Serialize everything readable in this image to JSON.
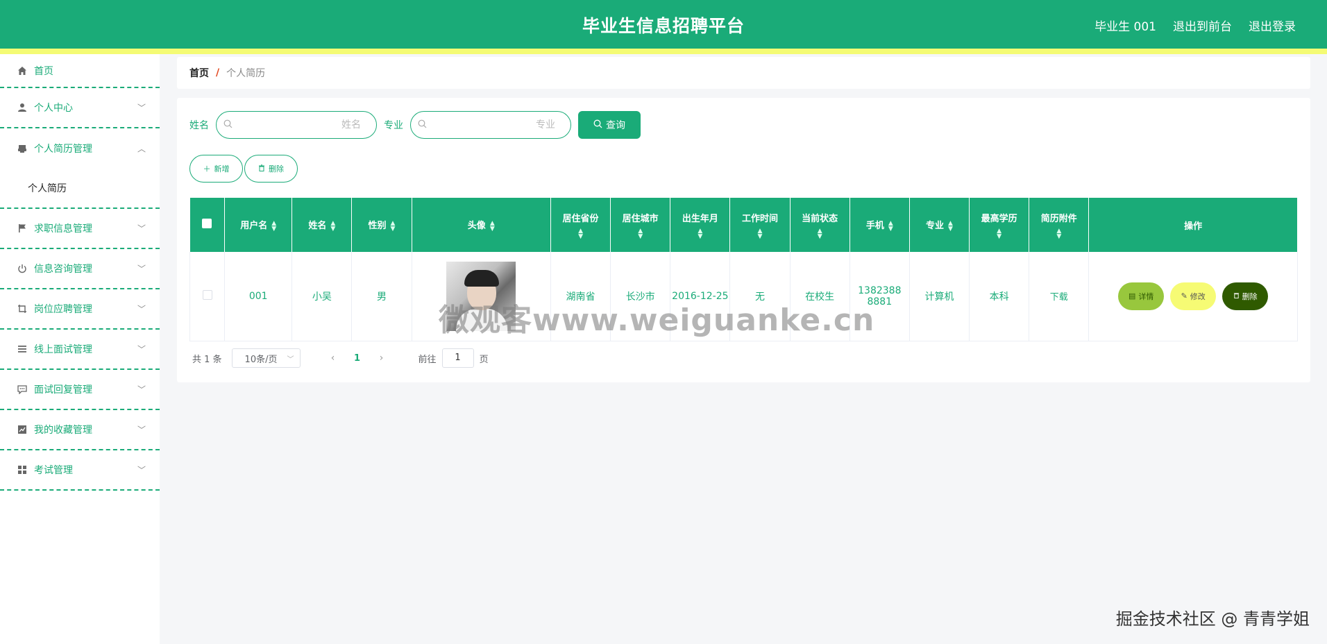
{
  "header": {
    "title": "毕业生信息招聘平台",
    "user": "毕业生 001",
    "to_front": "退出到前台",
    "logout": "退出登录"
  },
  "sidebar": {
    "items": [
      {
        "label": "首页",
        "icon": "home-icon"
      },
      {
        "label": "个人中心",
        "icon": "user-icon"
      },
      {
        "label": "个人简历管理",
        "icon": "printer-icon"
      },
      {
        "label": "个人简历",
        "icon": ""
      },
      {
        "label": "求职信息管理",
        "icon": "flag-icon"
      },
      {
        "label": "信息咨询管理",
        "icon": "power-icon"
      },
      {
        "label": "岗位应聘管理",
        "icon": "crop-icon"
      },
      {
        "label": "线上面试管理",
        "icon": "list-icon"
      },
      {
        "label": "面试回复管理",
        "icon": "chat-icon"
      },
      {
        "label": "我的收藏管理",
        "icon": "chart-icon"
      },
      {
        "label": "考试管理",
        "icon": "grid-icon"
      }
    ]
  },
  "breadcrumb": {
    "home": "首页",
    "sep": "/",
    "current": "个人简历"
  },
  "search": {
    "name_label": "姓名",
    "name_placeholder": "姓名",
    "major_label": "专业",
    "major_placeholder": "专业",
    "query_label": "查询"
  },
  "actions": {
    "add_label": "新增",
    "delete_label": "删除"
  },
  "table": {
    "headers": [
      "用户名",
      "姓名",
      "性别",
      "头像",
      "居住省份",
      "居住城市",
      "出生年月",
      "工作时间",
      "当前状态",
      "手机",
      "专业",
      "最高学历",
      "简历附件",
      "操作"
    ],
    "row": {
      "username": "001",
      "name": "小吴",
      "gender": "男",
      "province": "湖南省",
      "city": "长沙市",
      "birth": "2016-12-25",
      "work_time": "无",
      "status": "在校生",
      "phone": "13823888881",
      "major": "计算机",
      "education": "本科",
      "attachment": "下载",
      "op_detail": "详情",
      "op_edit": "修改",
      "op_delete": "删除"
    }
  },
  "pager": {
    "total": "共 1 条",
    "page_size": "10条/页",
    "current_page": "1",
    "goto_label": "前往",
    "goto_value": "1",
    "page_suffix": "页"
  },
  "watermarks": {
    "center": "微观客www.weiguanke.cn",
    "corner": "掘金技术社区 @ 青青学姐"
  },
  "colors": {
    "primary": "#1aab78",
    "stripe": "#f4fb74",
    "detail": "#98c73d",
    "edit": "#f6fb74",
    "delete": "#2f5a00"
  }
}
